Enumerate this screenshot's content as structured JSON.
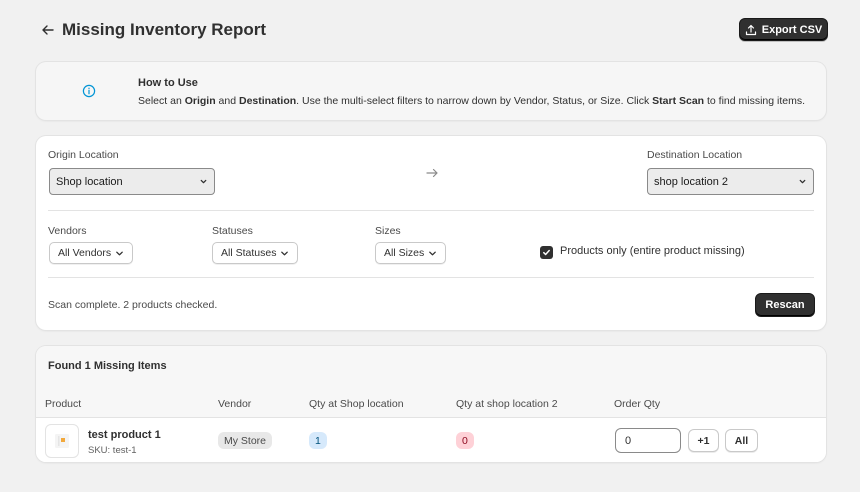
{
  "header": {
    "title": "Missing Inventory Report",
    "export_label": "Export CSV"
  },
  "howto": {
    "title": "How to Use",
    "text_parts": [
      "Select an ",
      "Origin",
      " and ",
      "Destination",
      ". Use the multi-select filters to narrow down by Vendor, Status, or Size. Click ",
      "Start Scan",
      " to find missing items."
    ]
  },
  "scan": {
    "origin_label": "Origin Location",
    "origin_value": "Shop location",
    "destination_label": "Destination Location",
    "destination_value": "shop location 2",
    "vendors_label": "Vendors",
    "vendors_value": "All Vendors",
    "statuses_label": "Statuses",
    "statuses_value": "All Statuses",
    "sizes_label": "Sizes",
    "sizes_value": "All Sizes",
    "products_only_label": "Products only (entire product missing)",
    "products_only_checked": true,
    "status_text": "Scan complete. 2 products checked.",
    "rescan_label": "Rescan"
  },
  "results": {
    "title": "Found 1 Missing Items",
    "columns": [
      "Product",
      "Vendor",
      "Qty at Shop location",
      "Qty at shop location 2",
      "Order Qty"
    ],
    "rows": [
      {
        "product": "test product 1",
        "sku": "SKU: test-1",
        "vendor": "My Store",
        "qty_origin": "1",
        "qty_destination": "0",
        "order_qty": "0",
        "plus_one_label": "+1",
        "all_label": "All"
      }
    ]
  },
  "colors": {
    "primary_button": "#303030",
    "info_icon": "#0094d5",
    "badge_info_bg": "#d6e9fb",
    "badge_critical_bg": "#fed1d7",
    "page_bg": "#f1f1f1"
  },
  "icons": {
    "back": "arrow-left-icon",
    "export": "upload-icon",
    "info": "info-circle-icon",
    "direction": "arrow-right-icon",
    "dropdown": "chevron-down-icon",
    "check": "checkmark-icon",
    "thumbnail": "product-image-icon"
  }
}
